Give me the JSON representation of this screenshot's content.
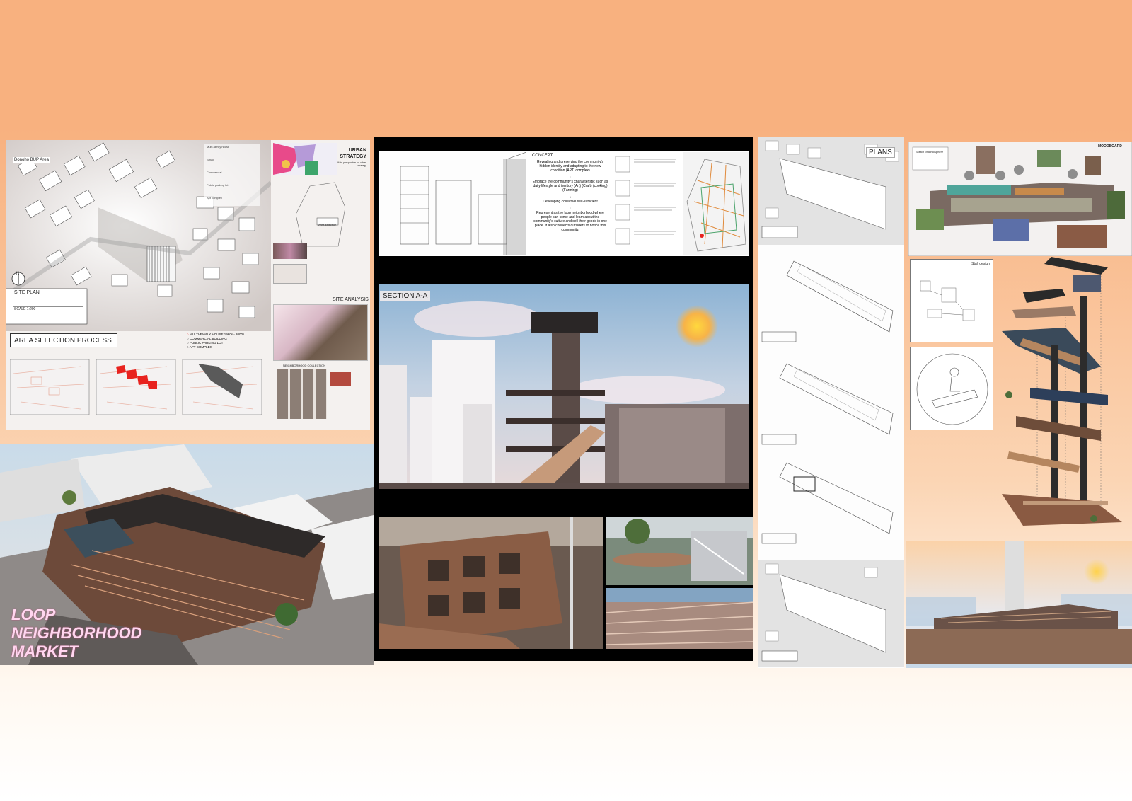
{
  "panel1": {
    "area_label": "Donoho BUP Area",
    "site_plan_label": "SITE PLAN",
    "scale_label": "SCALE 1:200",
    "north_label": "N",
    "urban_strategy_title": "URBAN STRATEGY",
    "urban_strategy_sub": "Main perspective for urban strategy",
    "site_analysis_title": "SITE ANALYSIS",
    "area_selection_title": "AREA SELECTION PROCESS",
    "legend": [
      "MULTI-FAMILY HOUSE 1960s - 2000s",
      "COMMERCIAL BUILDING",
      "PUBLIC PARKING LOT",
      "APT COMPLEX"
    ],
    "neighborhood_collection": "NEIGHBORHOOD COLLECTION",
    "strategy_items": [
      "Multi-family house",
      "Small",
      "Commercial",
      "Public parking lot",
      "Apt complex"
    ],
    "area_selection_tag": "Area selection"
  },
  "title_block": {
    "line1": "LOOP",
    "line2": "NEIGHBORHOOD",
    "line3": "MARKET"
  },
  "panel2": {
    "concept_title": "CONCEPT",
    "concept_lines": [
      "Revealing and preserving the community's hidden identity and adapting to the new condition (APT. complex)",
      "Embrace the community's characteristic such as daily lifestyle and territory (Art) (Craft) (cooking) (Farming)",
      "Developing collective self-sufficient",
      "Represent as the loop neighborhood where people can come and learn about the community's culture and sell their goods in one place. It also connects outsiders to notice this community."
    ],
    "section_label": "SECTION A-A"
  },
  "panel3": {
    "plans_title": "PLANS"
  },
  "panel4": {
    "moodboard_title": "MOODBOARD",
    "stall_design_title": "Stall design",
    "moodboard_tag": "Sketch of Atmosphere"
  },
  "colors": {
    "background_top": "#f8b17f",
    "title_pink": "#ffd6ef",
    "highlight_red": "#e8231f"
  }
}
